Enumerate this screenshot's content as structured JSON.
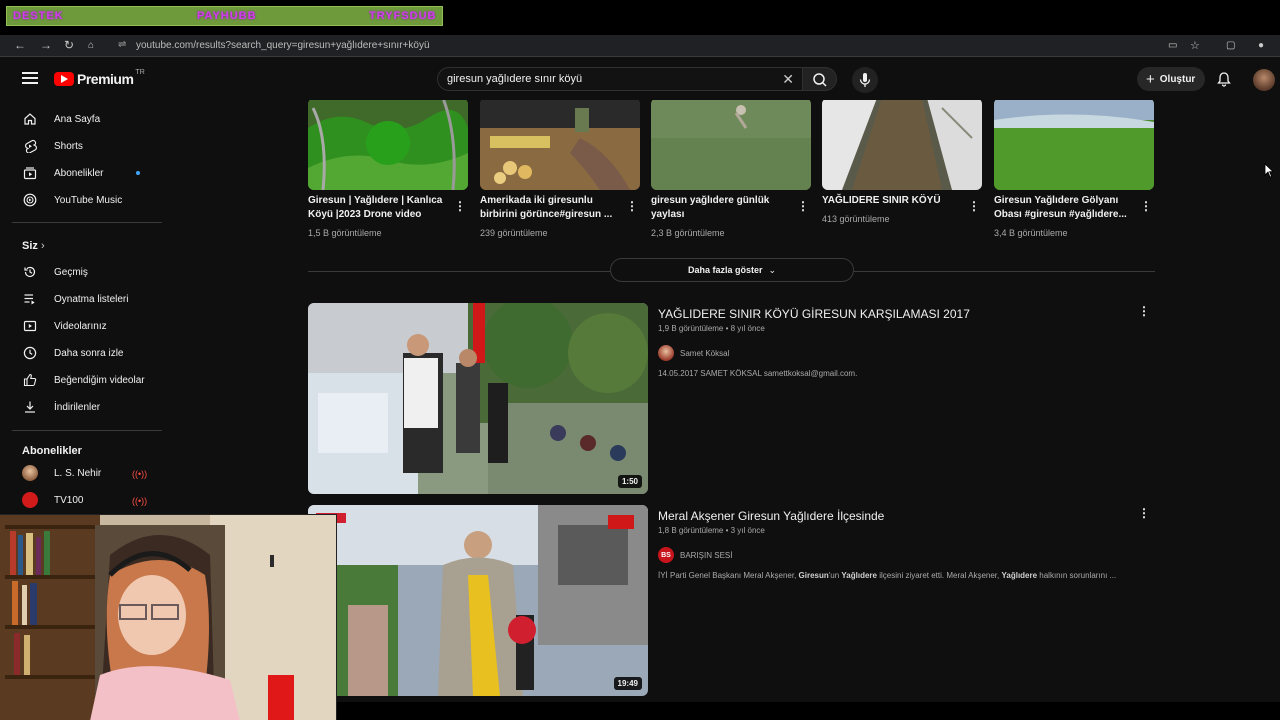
{
  "overlay": {
    "labels": [
      "DESTEK",
      "PAYHUBB",
      "TRYFSDUB"
    ]
  },
  "browser": {
    "url": "youtube.com/results?search_query=giresun+yağlıdere+sınır+köyü"
  },
  "header": {
    "logo_text": "Premium",
    "logo_region": "TR",
    "search_value": "giresun yağlıdere sınır köyü",
    "create_label": "Oluştur"
  },
  "sidebar": {
    "main_items": [
      {
        "label": "Ana Sayfa",
        "icon": "home-icon"
      },
      {
        "label": "Shorts",
        "icon": "shorts-icon"
      },
      {
        "label": "Abonelikler",
        "icon": "subscriptions-icon"
      },
      {
        "label": "YouTube Music",
        "icon": "music-icon"
      }
    ],
    "you_heading": "Siz",
    "you_items": [
      {
        "label": "Geçmiş",
        "icon": "history-icon"
      },
      {
        "label": "Oynatma listeleri",
        "icon": "playlist-icon"
      },
      {
        "label": "Videolarınız",
        "icon": "your-videos-icon"
      },
      {
        "label": "Daha sonra izle",
        "icon": "clock-icon"
      },
      {
        "label": "Beğendiğim videolar",
        "icon": "like-icon"
      },
      {
        "label": "İndirilenler",
        "icon": "download-icon"
      }
    ],
    "subs_heading": "Abonelikler",
    "subscriptions": [
      {
        "label": "L. S. Nehir",
        "color": "#c98a55"
      },
      {
        "label": "TV100",
        "color": "#d11a1a"
      }
    ]
  },
  "shorts": [
    {
      "title": "Giresun | Yağlıdere | Kanlıca Köyü |2023 Drone  video",
      "views": "1,5 B görüntüleme"
    },
    {
      "title": "Amerikada iki giresunlu birbirini görünce#giresun ...",
      "views": "239 görüntüleme"
    },
    {
      "title": "giresun yağlıdere günlük yaylası",
      "views": "2,3 B görüntüleme"
    },
    {
      "title": "YAĞLIDERE SINIR KÖYÜ",
      "views": "413 görüntüleme"
    },
    {
      "title": "Giresun Yağlıdere Gölyanı Obası #giresun #yağlıdere...",
      "views": "3,4 B görüntüleme"
    }
  ],
  "more_button": "Daha fazla göster",
  "videos": [
    {
      "title": "YAĞLIDERE SINIR KÖYÜ GİRESUN KARŞILAMASI 2017",
      "meta": "1,9 B görüntüleme • 8 yıl önce",
      "channel": "Samet Köksal",
      "channel_badge": "",
      "description": "14.05.2017 SAMET KÖKSAL samettkoksal@gmail.com.",
      "duration": "1:50"
    },
    {
      "title": "Meral Akşener Giresun Yağlıdere İlçesinde",
      "meta": "1,8 B görüntüleme • 3 yıl önce",
      "channel": "BARIŞIN SESİ",
      "channel_badge": "BS",
      "desc_parts": [
        "İYİ Parti Genel Başkanı Meral Akşener, ",
        "Giresun",
        "'un ",
        "Yağlıdere",
        " ilçesini ziyaret etti. Meral Akşener, ",
        "Yağlıdere",
        " halkının sorunlarını ..."
      ],
      "duration": "19:49"
    }
  ],
  "colors": {
    "background": "#0f0f0f",
    "accent": "#ff0000",
    "text_secondary": "#aaaaaa",
    "overlay_bar": "#6f9a3c"
  }
}
